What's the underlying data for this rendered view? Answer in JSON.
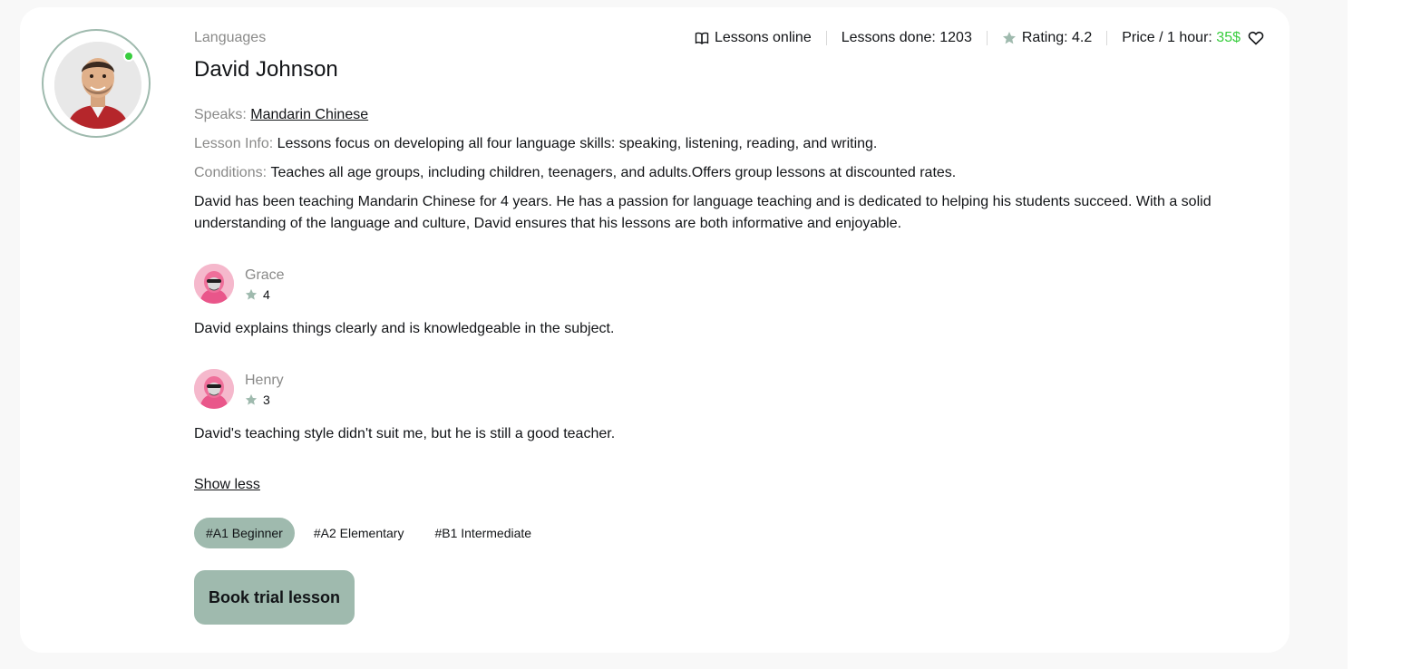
{
  "teacher": {
    "category": "Languages",
    "name": "David Johnson",
    "online": true
  },
  "stats": {
    "lessons_online": "Lessons online",
    "lessons_done": "Lessons done: 1203",
    "rating": "Rating: 4.2",
    "price_label": "Price / 1 hour: ",
    "price_value": "35$"
  },
  "info": {
    "speaks_label": "Speaks: ",
    "speaks_value": "Mandarin Chinese",
    "lesson_info_label": "Lesson Info: ",
    "lesson_info_value": "Lessons focus on developing all four language skills: speaking, listening, reading, and writing.",
    "conditions_label": "Conditions: ",
    "conditions_value": "Teaches all age groups, including children, teenagers, and adults.Offers group lessons at discounted rates."
  },
  "description": "David has been teaching Mandarin Chinese for 4 years. He has a passion for language teaching and is dedicated to helping his students succeed. With a solid understanding of the language and culture, David ensures that his lessons are both informative and enjoyable.",
  "reviews": [
    {
      "name": "Grace",
      "rating": "4",
      "comment": "David explains things clearly and is knowledgeable in the subject."
    },
    {
      "name": "Henry",
      "rating": "3",
      "comment": "David's teaching style didn't suit me, but he is still a good teacher."
    }
  ],
  "show_less_label": "Show less",
  "levels": [
    "#A1 Beginner",
    "#A2 Elementary",
    "#B1 Intermediate"
  ],
  "book_button_label": "Book trial lesson",
  "colors": {
    "accent": "#9fbaae",
    "online": "#38cd3e",
    "price": "#38cd3e",
    "muted_text": "#8a8a89",
    "text": "#121417"
  },
  "icons": {
    "lessons_online": "book-open-icon",
    "rating": "star-icon",
    "favorite": "heart-icon"
  }
}
